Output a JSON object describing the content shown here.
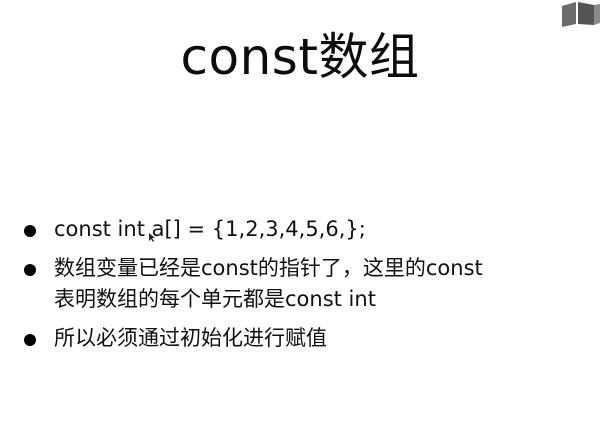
{
  "slide": {
    "title": "const数组",
    "bullets": [
      "const int a[] = {1,2,3,4,5,6,};",
      "数组变量已经是const的指针了，这里的const\n表明数组的每个单元都是const int",
      "所以必须通过初始化进行赋值"
    ]
  },
  "icons": {
    "corner": "book-icon",
    "cursor": "mouse-cursor-icon"
  },
  "colors": {
    "background": "#ffffff",
    "text": "#111111",
    "corner_icon": "#6b6b6b"
  }
}
